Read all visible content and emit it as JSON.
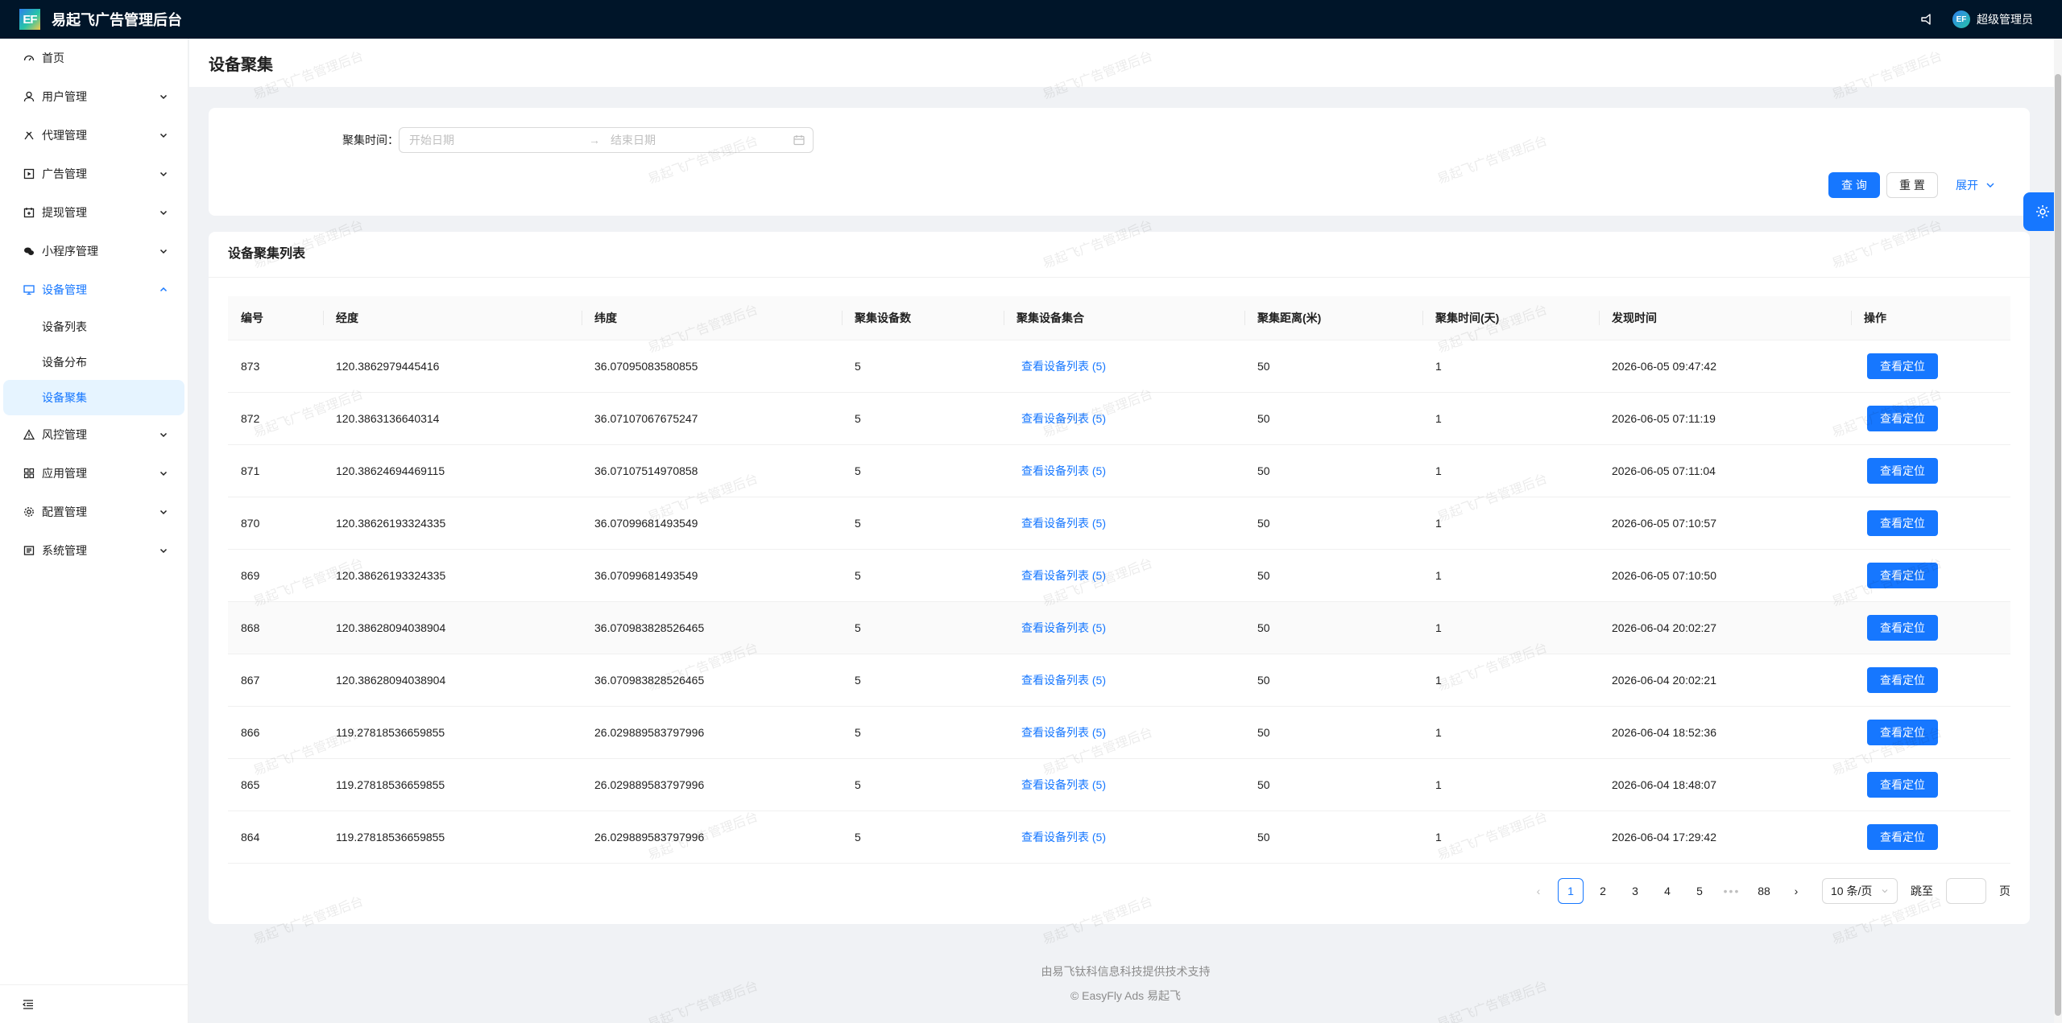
{
  "app": {
    "logo": "EF",
    "title": "易起飞广告管理后台"
  },
  "header": {
    "user": "超级管理员",
    "avatar": "EF"
  },
  "sidebar": {
    "items": [
      {
        "label": "首页",
        "icon": "dashboard-icon"
      },
      {
        "label": "用户管理",
        "icon": "user-icon"
      },
      {
        "label": "代理管理",
        "icon": "agent-icon"
      },
      {
        "label": "广告管理",
        "icon": "ad-icon"
      },
      {
        "label": "提现管理",
        "icon": "withdraw-icon"
      },
      {
        "label": "小程序管理",
        "icon": "wechat-icon"
      },
      {
        "label": "设备管理",
        "icon": "monitor-icon"
      },
      {
        "label": "风控管理",
        "icon": "warning-icon"
      },
      {
        "label": "应用管理",
        "icon": "apps-icon"
      },
      {
        "label": "配置管理",
        "icon": "gear-icon"
      },
      {
        "label": "系统管理",
        "icon": "system-icon"
      }
    ],
    "device_sub": [
      "设备列表",
      "设备分布",
      "设备聚集"
    ]
  },
  "page": {
    "title": "设备聚集"
  },
  "search": {
    "label": "聚集时间：",
    "start_placeholder": "开始日期",
    "end_placeholder": "结束日期",
    "query_btn": "查 询",
    "reset_btn": "重 置",
    "expand_btn": "展开"
  },
  "list": {
    "title": "设备聚集列表",
    "columns": [
      "编号",
      "经度",
      "纬度",
      "聚集设备数",
      "聚集设备集合",
      "聚集距离(米)",
      "聚集时间(天)",
      "发现时间",
      "操作"
    ],
    "rows": [
      [
        "873",
        "120.3862979445416",
        "36.07095083580855",
        "5",
        "查看设备列表 (5)",
        "50",
        "1",
        "2026-06-05 09:47:42",
        "查看定位"
      ],
      [
        "872",
        "120.3863136640314",
        "36.07107067675247",
        "5",
        "查看设备列表 (5)",
        "50",
        "1",
        "2026-06-05 07:11:19",
        "查看定位"
      ],
      [
        "871",
        "120.38624694469115",
        "36.07107514970858",
        "5",
        "查看设备列表 (5)",
        "50",
        "1",
        "2026-06-05 07:11:04",
        "查看定位"
      ],
      [
        "870",
        "120.38626193324335",
        "36.07099681493549",
        "5",
        "查看设备列表 (5)",
        "50",
        "1",
        "2026-06-05 07:10:57",
        "查看定位"
      ],
      [
        "869",
        "120.38626193324335",
        "36.07099681493549",
        "5",
        "查看设备列表 (5)",
        "50",
        "1",
        "2026-06-05 07:10:50",
        "查看定位"
      ],
      [
        "868",
        "120.38628094038904",
        "36.070983828526465",
        "5",
        "查看设备列表 (5)",
        "50",
        "1",
        "2026-06-04 20:02:27",
        "查看定位"
      ],
      [
        "867",
        "120.38628094038904",
        "36.070983828526465",
        "5",
        "查看设备列表 (5)",
        "50",
        "1",
        "2026-06-04 20:02:21",
        "查看定位"
      ],
      [
        "866",
        "119.27818536659855",
        "26.029889583797996",
        "5",
        "查看设备列表 (5)",
        "50",
        "1",
        "2026-06-04 18:52:36",
        "查看定位"
      ],
      [
        "865",
        "119.27818536659855",
        "26.029889583797996",
        "5",
        "查看设备列表 (5)",
        "50",
        "1",
        "2026-06-04 18:48:07",
        "查看定位"
      ],
      [
        "864",
        "119.27818536659855",
        "26.029889583797996",
        "5",
        "查看设备列表 (5)",
        "50",
        "1",
        "2026-06-04 17:29:42",
        "查看定位"
      ]
    ]
  },
  "pagination": {
    "pages": [
      "1",
      "2",
      "3",
      "4",
      "5",
      "•••",
      "88"
    ],
    "current": "1",
    "page_size": "10 条/页",
    "jump_label": "跳至",
    "page_suffix": "页"
  },
  "footer": {
    "line1": "由易飞钛科信息科技提供技术支持",
    "line2": "© EasyFly Ads 易起飞"
  },
  "watermark": "易起飞广告管理后台",
  "colors": {
    "primary": "#1677ff",
    "header_bg": "#001529"
  }
}
